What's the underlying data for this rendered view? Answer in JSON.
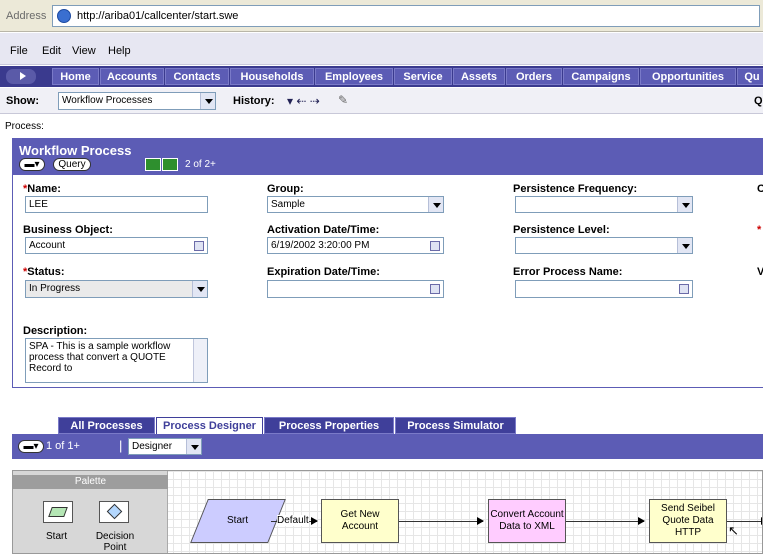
{
  "browser": {
    "address_label": "Address",
    "url": "http://ariba01/callcenter/start.swe"
  },
  "menu": [
    "File",
    "Edit",
    "View",
    "Help"
  ],
  "tabs": [
    "Home",
    "Accounts",
    "Contacts",
    "Households",
    "Employees",
    "Service",
    "Assets",
    "Orders",
    "Campaigns",
    "Opportunities",
    "Qu"
  ],
  "toolbar": {
    "show_label": "Show:",
    "show_value": "Workflow Processes",
    "history_label": "History:",
    "right_cut": "Q"
  },
  "process_label": "Process:",
  "workflow": {
    "title": "Workflow Process",
    "query_label": "Query",
    "record_count": "2 of 2+",
    "fields": {
      "name_label": "Name:",
      "name_value": "LEE",
      "business_object_label": "Business Object:",
      "business_object_value": "Account",
      "status_label": "Status:",
      "status_value": "In Progress",
      "description_label": "Description:",
      "description_value": "SPA - This is a sample workflow process that convert a QUOTE  Record to",
      "group_label": "Group:",
      "group_value": "Sample",
      "activation_label": "Activation Date/Time:",
      "activation_value": "6/19/2002 3:20:00 PM",
      "expiration_label": "Expiration Date/Time:",
      "expiration_value": "",
      "persistence_frequency_label": "Persistence Frequency:",
      "persistence_level_label": "Persistence Level:",
      "error_process_label": "Error Process Name:",
      "cut_labels": [
        "C",
        "*",
        "V"
      ]
    }
  },
  "bottom_tabs": [
    "All Processes",
    "Process Designer",
    "Process Properties",
    "Process Simulator"
  ],
  "designer_bar": {
    "count": "1 of 1+",
    "view_value": "Designer"
  },
  "palette": {
    "title": "Palette",
    "items": [
      "Start",
      "Decision Point"
    ]
  },
  "flow": {
    "start": "Start",
    "default_label": "Default",
    "step1": "Get New Account",
    "step2": "Convert Account Data to XML",
    "step3": "Send Seibel Quote Data HTTP"
  },
  "colors": {
    "brand": "#5c5cb5",
    "dark": "#3a3a8e",
    "step_yellow": "#ffffcc",
    "step_pink": "#ffccff",
    "start_purple": "#ccccff"
  }
}
